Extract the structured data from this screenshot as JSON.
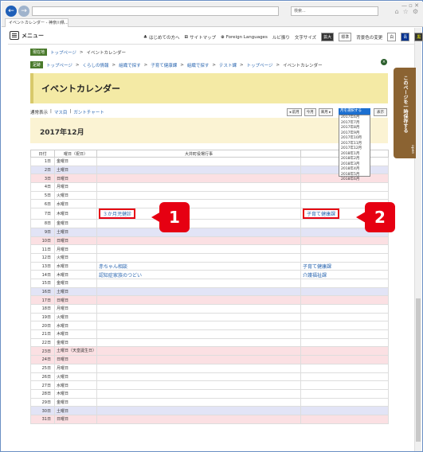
{
  "browser": {
    "tab_title": "イベントカレンダー - 神奈川県...",
    "search_placeholder": "検索..."
  },
  "header": {
    "menu_label": "メニュー",
    "links": [
      "はじめての方へ",
      "サイトマップ",
      "Foreign Languages",
      "ルビ振り",
      "文字サイズ"
    ],
    "size_buttons": [
      "拡大",
      "標準"
    ],
    "color_label": "背景色の変更",
    "color_buttons": [
      "白",
      "青",
      "黒"
    ]
  },
  "breadcrumbs": {
    "current_badge": "現在地",
    "current": [
      "トップページ",
      "イベントカレンダー"
    ],
    "history_badge": "足跡",
    "history": [
      "トップページ",
      "くらしの情報",
      "組織で探す",
      "子育て健康課",
      "組織で探す",
      "テスト課",
      "トップページ",
      "イベントカレンダー"
    ]
  },
  "page": {
    "title": "イベントカレンダー",
    "view_normal": "通常表示",
    "view_month": "マス目",
    "view_gantt": "ガントチャート",
    "prev_month": "前月",
    "this_month": "今月",
    "next_month": "来月",
    "select_label": "月を選択する",
    "display_button": "表示",
    "month_heading": "2017年12月",
    "month_options": [
      "2017年6月",
      "2017年7月",
      "2017年8月",
      "2017年9月",
      "2017年10月",
      "2017年11月",
      "2017年12月",
      "2018年1月",
      "2018年2月",
      "2018年3月",
      "2018年4月",
      "2018年5月",
      "2018年6月"
    ]
  },
  "side_tab": {
    "label": "このページを一時保存する",
    "open": "open"
  },
  "table": {
    "headers": [
      "日付",
      "曜日（祝日）",
      "大井町役場行事",
      ""
    ],
    "rows": [
      {
        "date": "1日",
        "day": "金曜日",
        "type": "",
        "ev1": "",
        "ev2": ""
      },
      {
        "date": "2日",
        "day": "土曜日",
        "type": "sat",
        "ev1": "",
        "ev2": ""
      },
      {
        "date": "3日",
        "day": "日曜日",
        "type": "sun",
        "ev1": "",
        "ev2": ""
      },
      {
        "date": "4日",
        "day": "月曜日",
        "type": "",
        "ev1": "",
        "ev2": ""
      },
      {
        "date": "5日",
        "day": "火曜日",
        "type": "",
        "ev1": "",
        "ev2": ""
      },
      {
        "date": "6日",
        "day": "水曜日",
        "type": "",
        "ev1": "",
        "ev2": ""
      },
      {
        "date": "7日",
        "day": "木曜日",
        "type": "",
        "ev1": "３か月児健診",
        "ev2": "子育て健康課",
        "hl": true
      },
      {
        "date": "8日",
        "day": "金曜日",
        "type": "",
        "ev1": "",
        "ev2": ""
      },
      {
        "date": "9日",
        "day": "土曜日",
        "type": "sat",
        "ev1": "",
        "ev2": ""
      },
      {
        "date": "10日",
        "day": "日曜日",
        "type": "sun",
        "ev1": "",
        "ev2": ""
      },
      {
        "date": "11日",
        "day": "月曜日",
        "type": "",
        "ev1": "",
        "ev2": ""
      },
      {
        "date": "12日",
        "day": "火曜日",
        "type": "",
        "ev1": "",
        "ev2": ""
      },
      {
        "date": "13日",
        "day": "水曜日",
        "type": "",
        "ev1": "赤ちゃん相談",
        "ev2": "子育て健康課"
      },
      {
        "date": "14日",
        "day": "木曜日",
        "type": "",
        "ev1": "認知症家族のつどい",
        "ev2": "介護福祉課"
      },
      {
        "date": "15日",
        "day": "金曜日",
        "type": "",
        "ev1": "",
        "ev2": ""
      },
      {
        "date": "16日",
        "day": "土曜日",
        "type": "sat",
        "ev1": "",
        "ev2": ""
      },
      {
        "date": "17日",
        "day": "日曜日",
        "type": "sun",
        "ev1": "",
        "ev2": ""
      },
      {
        "date": "18日",
        "day": "月曜日",
        "type": "",
        "ev1": "",
        "ev2": ""
      },
      {
        "date": "19日",
        "day": "火曜日",
        "type": "",
        "ev1": "",
        "ev2": ""
      },
      {
        "date": "20日",
        "day": "水曜日",
        "type": "",
        "ev1": "",
        "ev2": ""
      },
      {
        "date": "21日",
        "day": "木曜日",
        "type": "",
        "ev1": "",
        "ev2": ""
      },
      {
        "date": "22日",
        "day": "金曜日",
        "type": "",
        "ev1": "",
        "ev2": ""
      },
      {
        "date": "23日",
        "day": "土曜日（天皇誕生日）",
        "type": "sun",
        "ev1": "",
        "ev2": ""
      },
      {
        "date": "24日",
        "day": "日曜日",
        "type": "sun",
        "ev1": "",
        "ev2": ""
      },
      {
        "date": "25日",
        "day": "月曜日",
        "type": "",
        "ev1": "",
        "ev2": ""
      },
      {
        "date": "26日",
        "day": "火曜日",
        "type": "",
        "ev1": "",
        "ev2": ""
      },
      {
        "date": "27日",
        "day": "水曜日",
        "type": "",
        "ev1": "",
        "ev2": ""
      },
      {
        "date": "28日",
        "day": "木曜日",
        "type": "",
        "ev1": "",
        "ev2": ""
      },
      {
        "date": "29日",
        "day": "金曜日",
        "type": "",
        "ev1": "",
        "ev2": ""
      },
      {
        "date": "30日",
        "day": "土曜日",
        "type": "sat",
        "ev1": "",
        "ev2": ""
      },
      {
        "date": "31日",
        "day": "日曜日",
        "type": "sun",
        "ev1": "",
        "ev2": ""
      }
    ]
  },
  "callouts": [
    "1",
    "2"
  ]
}
